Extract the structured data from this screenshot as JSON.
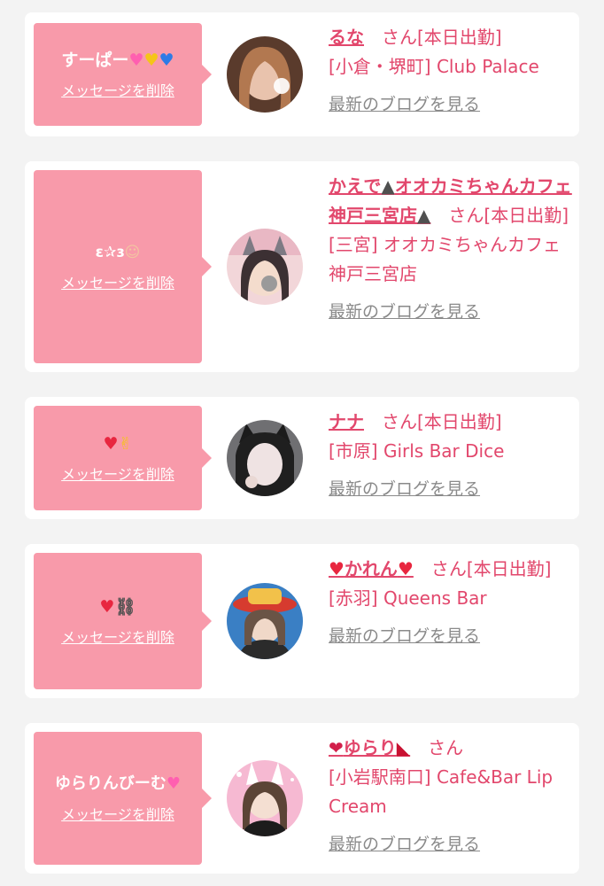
{
  "common": {
    "delete_label": "メッセージを削除",
    "blog_label": "最新のブログを見る"
  },
  "cards": [
    {
      "message": "すーぱー",
      "name": "るな",
      "honorific": "さん",
      "status": "[本日出勤]",
      "shop": "[小倉・堺町] Club Palace"
    },
    {
      "message": "ɛ✰ɜ",
      "name": "かえで",
      "name_mid": "オオカミちゃんカフェ神戸三宮店",
      "honorific": "さん",
      "status": "[本日出勤]",
      "shop": "[三宮] オオカミちゃんカフェ神戸三宮店"
    },
    {
      "message": "",
      "name": "ナナ",
      "honorific": "さん",
      "status": "[本日出勤]",
      "shop": "[市原] Girls Bar Dice"
    },
    {
      "message": "",
      "name": "かれん",
      "honorific": "さん",
      "status": "[本日出勤]",
      "shop": "[赤羽] Queens Bar"
    },
    {
      "message": "ゆらりんびーむ",
      "name": "ゆらり",
      "honorific": "さん",
      "status": "",
      "shop": "[小岩駅南口] Cafe&Bar Lip Cream"
    }
  ],
  "icons": {
    "card1_message": [
      "pink-heart-icon",
      "yellow-heart-icon",
      "blue-heart-icon"
    ],
    "card2_message": [
      "baby-face-icon"
    ],
    "card2_name": [
      "wolf-icon",
      "wolf-icon"
    ],
    "card3_message": [
      "red-heart-icon",
      "victory-hand-icon"
    ],
    "card4_message": [
      "mended-heart-icon",
      "chain-icon"
    ],
    "card4_name": [
      "mended-heart-icon",
      "mended-heart-icon"
    ],
    "card5_message": [
      "sparkling-heart-icon"
    ],
    "card5_name": [
      "kiss-mark-icon",
      "high-heel-icon"
    ]
  },
  "colors": {
    "bubble": "#f89aaa",
    "accent_text": "#e2476c",
    "link_gray": "#8a8a8a",
    "background": "#f3f3f3",
    "card": "#ffffff"
  }
}
